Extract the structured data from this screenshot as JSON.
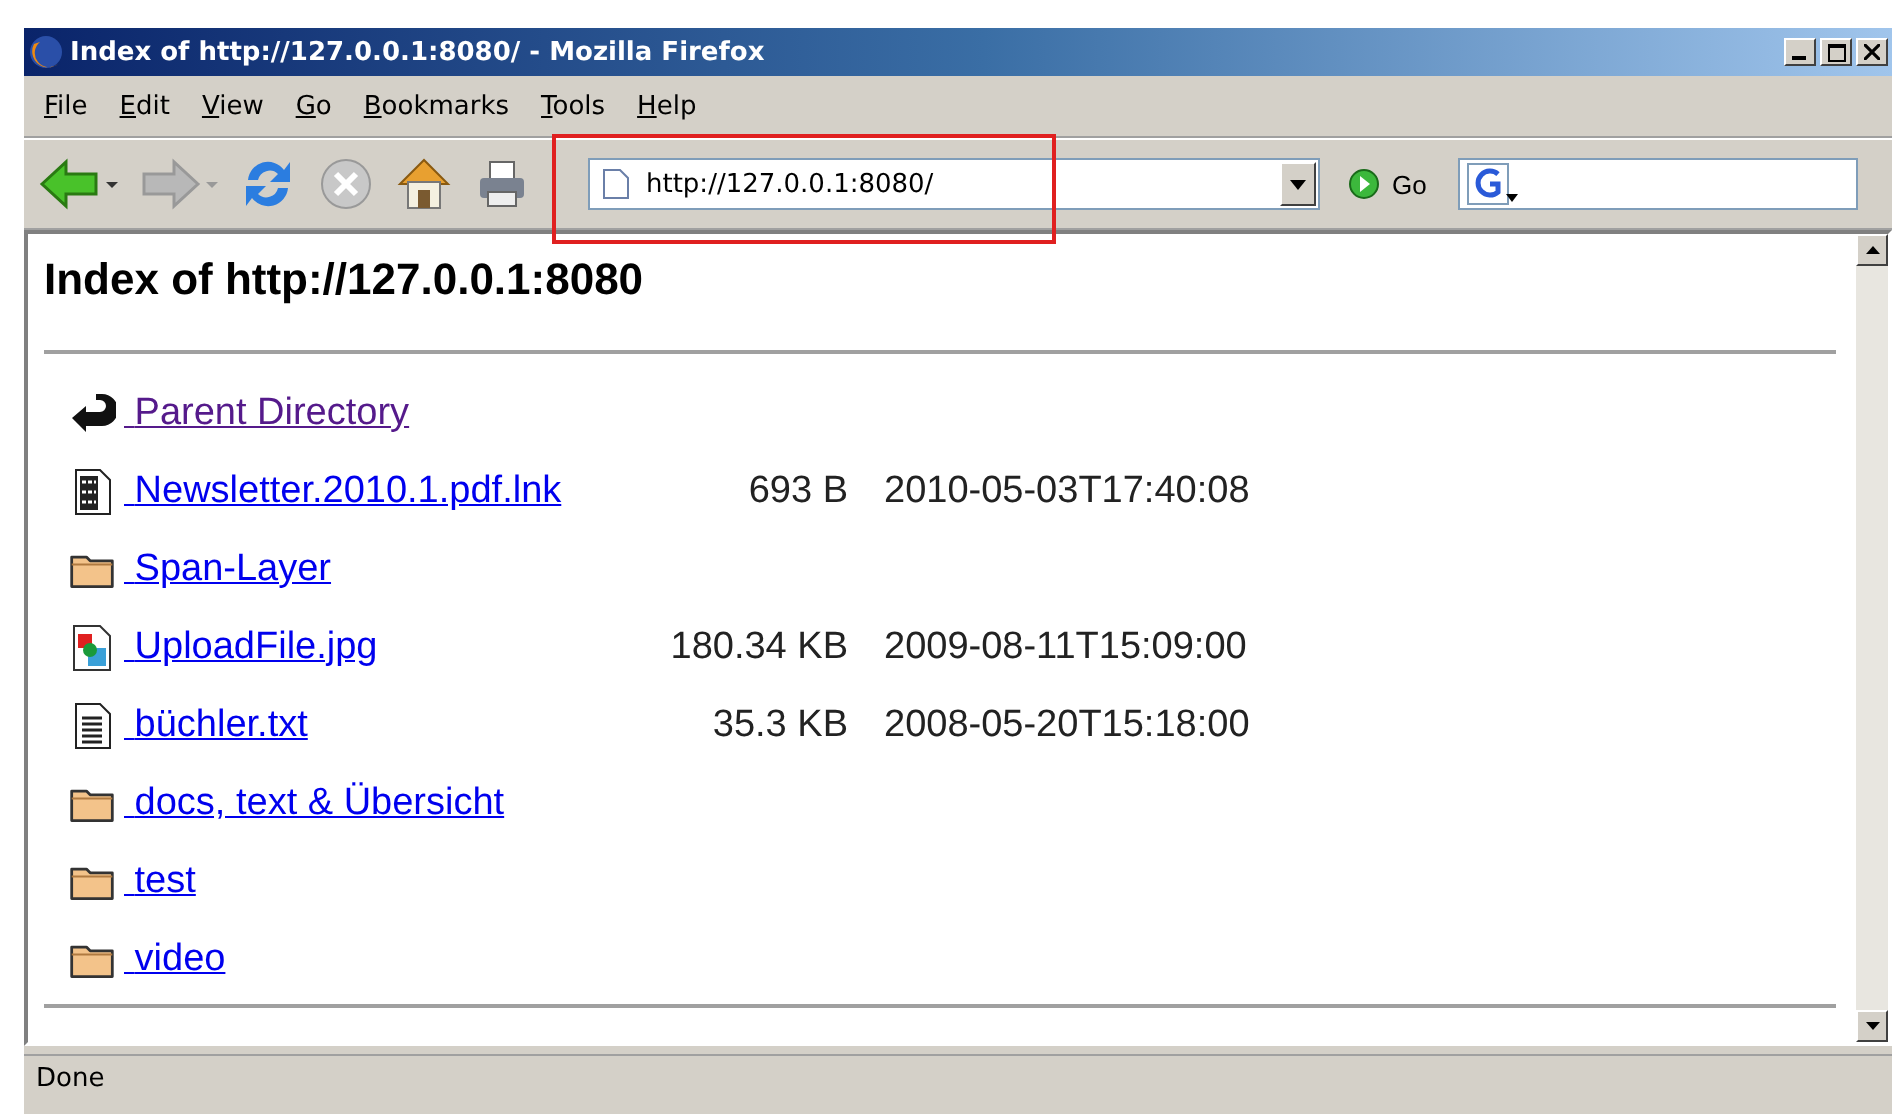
{
  "window": {
    "title": "Index of http://127.0.0.1:8080/ - Mozilla Firefox"
  },
  "menu": [
    "File",
    "Edit",
    "View",
    "Go",
    "Bookmarks",
    "Tools",
    "Help"
  ],
  "toolbar": [
    {
      "kind": "back",
      "disabled": false
    },
    {
      "kind": "forward",
      "disabled": true
    },
    {
      "kind": "reload",
      "disabled": false
    },
    {
      "kind": "stop",
      "disabled": true
    },
    {
      "kind": "home",
      "disabled": false
    },
    {
      "kind": "print",
      "disabled": false
    }
  ],
  "address": {
    "value": "http://127.0.0.1:8080/",
    "highlighted": true
  },
  "go_button": "Go",
  "page": {
    "heading": "Index of http://127.0.0.1:8080",
    "entries": [
      {
        "kind": "parent",
        "name": "Parent Directory",
        "visited": true
      },
      {
        "kind": "binary",
        "name": "Newsletter.2010.1.pdf.lnk",
        "size": "693 B",
        "modified": "2010-05-03T17:40:08",
        "visited": false
      },
      {
        "kind": "folder",
        "name": "Span-Layer",
        "visited": false
      },
      {
        "kind": "image",
        "name": "UploadFile.jpg",
        "size": "180.34 KB",
        "modified": "2009-08-11T15:09:00",
        "visited": false
      },
      {
        "kind": "text",
        "name": "büchler.txt",
        "size": "35.3 KB",
        "modified": "2008-05-20T15:18:00",
        "visited": false
      },
      {
        "kind": "folder",
        "name": "docs, text & Übersicht",
        "visited": false
      },
      {
        "kind": "folder",
        "name": "test",
        "visited": false
      },
      {
        "kind": "folder",
        "name": "video",
        "visited": false
      }
    ]
  },
  "status_bar": "Done"
}
